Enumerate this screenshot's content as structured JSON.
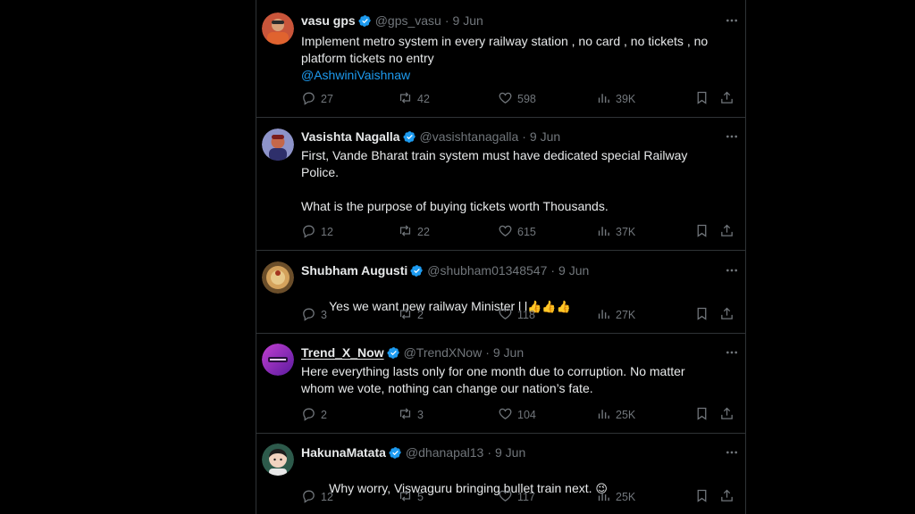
{
  "tweets": [
    {
      "name": "vasu gps",
      "handle": "@gps_vasu",
      "date": "9 Jun",
      "text": "Implement metro system in every railway station , no card , no tickets , no platform tickets no entry",
      "mention": "@AshwiniVaishnaw",
      "replies": "27",
      "retweets": "42",
      "likes": "598",
      "views": "39K",
      "avatar_color": "#b8452e"
    },
    {
      "name": "Vasishta Nagalla",
      "handle": "@vasishtanagalla",
      "date": "9 Jun",
      "text": "First, Vande Bharat train system must have dedicated special Railway Police.\n\nWhat is the purpose of buying tickets worth Thousands.",
      "replies": "12",
      "retweets": "22",
      "likes": "615",
      "views": "37K",
      "avatar_color": "#3b3f7a"
    },
    {
      "name": "Shubham Augusti",
      "handle": "@shubham01348547",
      "date": "9 Jun",
      "text": "Yes we want new railway Minister l l",
      "emoji": "👍👍👍",
      "replies": "3",
      "retweets": "2",
      "likes": "118",
      "views": "27K",
      "avatar_color": "#b38a4a"
    },
    {
      "name": "Trend_X_Now",
      "handle": "@TrendXNow",
      "date": "9 Jun",
      "text": "Here everything lasts only for one month due to corruption. No matter whom we vote, nothing can change our nation’s fate.",
      "replies": "2",
      "retweets": "3",
      "likes": "104",
      "views": "25K",
      "avatar_color": "#8e2fa8"
    },
    {
      "name": "HakunaMatata",
      "handle": "@dhanapal13",
      "date": "9 Jun",
      "text": "Why worry, Viswaguru bringing bullet train next.",
      "emoji": "😉",
      "replies": "12",
      "retweets": "5",
      "likes": "117",
      "views": "25K",
      "avatar_color": "#2a4a3e"
    }
  ],
  "colors": {
    "background": "#000000",
    "text": "#e7e9ea",
    "muted": "#71767b",
    "accent": "#1d9bf0",
    "divider": "#2f3336"
  },
  "icons": [
    "more-icon",
    "verified-icon",
    "reply-icon",
    "retweet-icon",
    "like-icon",
    "views-icon",
    "bookmark-icon",
    "share-icon"
  ]
}
